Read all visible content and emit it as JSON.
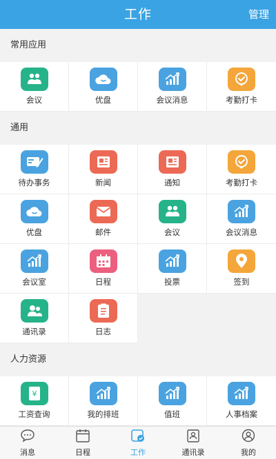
{
  "colors": {
    "accent": "#3aa3e3",
    "teal": "#26b38a",
    "blue": "#4aa3e0",
    "orange": "#f4a63b",
    "red": "#ec6a55",
    "pink": "#ec5f7e"
  },
  "header": {
    "title": "工作",
    "action": "管理"
  },
  "sections": [
    {
      "title": "常用应用",
      "items": [
        {
          "label": "会议",
          "icon": "meeting-icon",
          "color": "#26b38a"
        },
        {
          "label": "优盘",
          "icon": "cloud-icon",
          "color": "#4aa3e0"
        },
        {
          "label": "会议消息",
          "icon": "chart-icon",
          "color": "#4aa3e0"
        },
        {
          "label": "考勤打卡",
          "icon": "check-shield-icon",
          "color": "#f4a63b"
        }
      ]
    },
    {
      "title": "通用",
      "items": [
        {
          "label": "待办事务",
          "icon": "card-pen-icon",
          "color": "#4aa3e0"
        },
        {
          "label": "新闻",
          "icon": "newspaper-icon",
          "color": "#ec6a55"
        },
        {
          "label": "通知",
          "icon": "newspaper-icon",
          "color": "#ec6a55"
        },
        {
          "label": "考勤打卡",
          "icon": "check-shield-icon",
          "color": "#f4a63b"
        },
        {
          "label": "优盘",
          "icon": "cloud-icon",
          "color": "#4aa3e0"
        },
        {
          "label": "邮件",
          "icon": "mail-icon",
          "color": "#ec6a55"
        },
        {
          "label": "会议",
          "icon": "meeting-icon",
          "color": "#26b38a"
        },
        {
          "label": "会议消息",
          "icon": "chart-icon",
          "color": "#4aa3e0"
        },
        {
          "label": "会议室",
          "icon": "chart-icon",
          "color": "#4aa3e0"
        },
        {
          "label": "日程",
          "icon": "calendar-icon",
          "color": "#ec5f7e"
        },
        {
          "label": "投票",
          "icon": "chart-icon",
          "color": "#4aa3e0"
        },
        {
          "label": "签到",
          "icon": "location-pin-icon",
          "color": "#f4a63b"
        },
        {
          "label": "通讯录",
          "icon": "contacts-icon",
          "color": "#26b38a"
        },
        {
          "label": "日志",
          "icon": "notepad-icon",
          "color": "#ec6a55"
        }
      ]
    },
    {
      "title": "人力资源",
      "items": [
        {
          "label": "工资查询",
          "icon": "yen-book-icon",
          "color": "#26b38a"
        },
        {
          "label": "我的排班",
          "icon": "chart-icon",
          "color": "#4aa3e0"
        },
        {
          "label": "值班",
          "icon": "chart-icon",
          "color": "#4aa3e0"
        },
        {
          "label": "人事档案",
          "icon": "chart-icon",
          "color": "#4aa3e0"
        }
      ]
    }
  ],
  "tabs": [
    {
      "label": "消息",
      "icon": "chat-bubble-icon",
      "active": false
    },
    {
      "label": "日程",
      "icon": "calendar-tab-icon",
      "active": false
    },
    {
      "label": "工作",
      "icon": "work-check-icon",
      "active": true
    },
    {
      "label": "通讯录",
      "icon": "contact-book-icon",
      "active": false
    },
    {
      "label": "我的",
      "icon": "profile-icon",
      "active": false
    }
  ]
}
